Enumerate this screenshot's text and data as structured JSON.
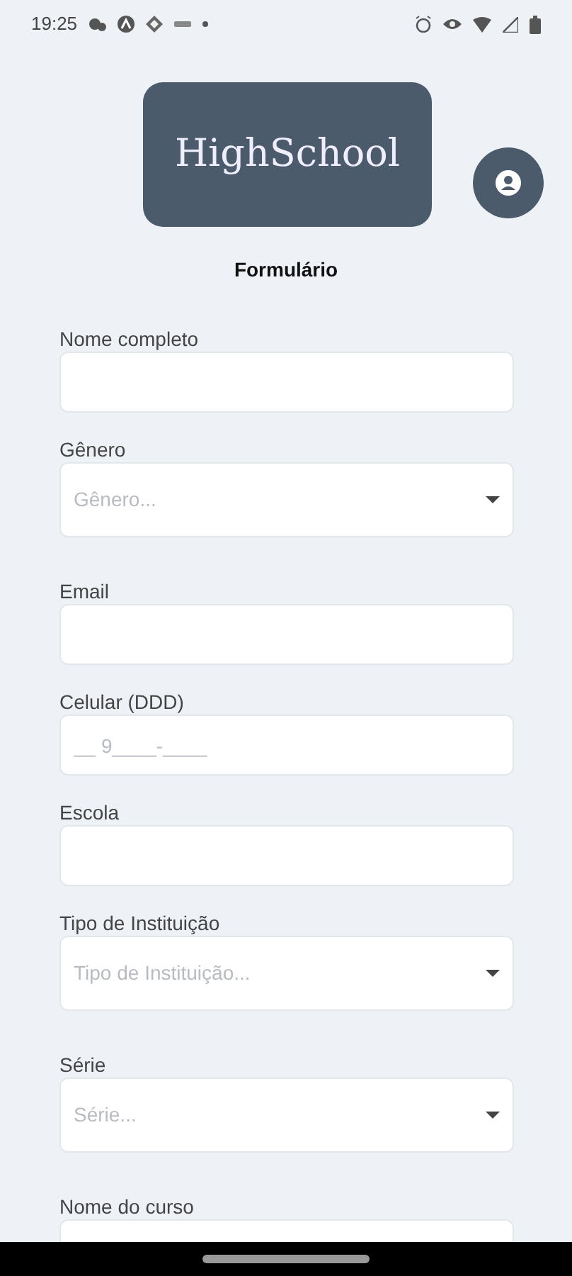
{
  "status_bar": {
    "time": "19:25"
  },
  "header": {
    "logo": "HighSchool",
    "title": "Formulário"
  },
  "form": {
    "fields": [
      {
        "kind": "text",
        "label": "Nome completo"
      },
      {
        "kind": "select",
        "label": "Gênero",
        "placeholder": "Gênero..."
      },
      {
        "kind": "text",
        "label": "Email"
      },
      {
        "kind": "text",
        "label": "Celular (DDD)",
        "placeholder": "__ 9____-____"
      },
      {
        "kind": "text",
        "label": "Escola"
      },
      {
        "kind": "select",
        "label": "Tipo de Instituição",
        "placeholder": "Tipo de Instituição..."
      },
      {
        "kind": "select",
        "label": "Série",
        "placeholder": "Série..."
      },
      {
        "kind": "text",
        "label": "Nome do curso"
      }
    ]
  }
}
